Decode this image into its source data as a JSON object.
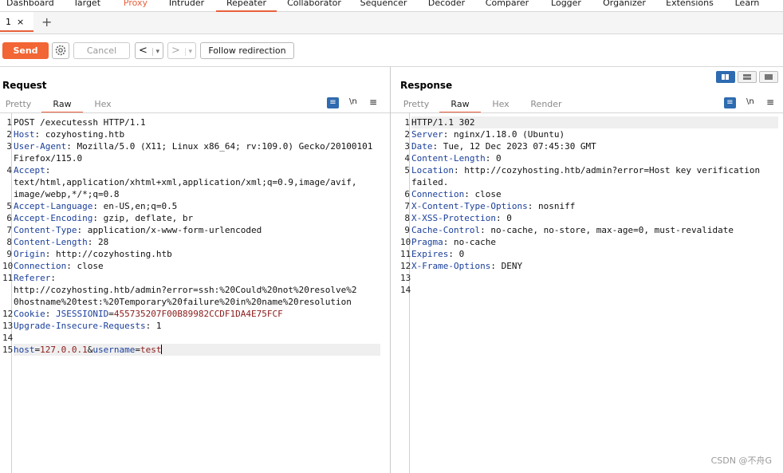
{
  "top_tabs": [
    "Dashboard",
    "Target",
    "Proxy",
    "Intruder",
    "Repeater",
    "Collaborator",
    "Sequencer",
    "Decoder",
    "Comparer",
    "Logger",
    "Organizer",
    "Extensions",
    "Learn"
  ],
  "repeater_tab": {
    "label": "1",
    "close": "×",
    "add": "+"
  },
  "toolbar": {
    "send": "Send",
    "cancel": "Cancel",
    "back": "<",
    "back_menu": "▾",
    "forward": ">",
    "forward_menu": "▾",
    "follow": "Follow redirection"
  },
  "request": {
    "title": "Request",
    "tabs": [
      "Pretty",
      "Raw",
      "Hex"
    ],
    "lines": [
      {
        "n": "1",
        "text": "POST /executessh HTTP/1.1"
      },
      {
        "n": "2",
        "key": "Host",
        "val": "cozyhosting.htb"
      },
      {
        "n": "3",
        "key": "User-Agent",
        "val": "Mozilla/5.0 (X11; Linux x86_64; rv:109.0) Gecko/20100101"
      },
      {
        "n": "",
        "text": "Firefox/115.0"
      },
      {
        "n": "4",
        "key": "Accept",
        "val": ""
      },
      {
        "n": "",
        "text": "text/html,application/xhtml+xml,application/xml;q=0.9,image/avif,"
      },
      {
        "n": "",
        "text": "image/webp,*/*;q=0.8"
      },
      {
        "n": "5",
        "key": "Accept-Language",
        "val": "en-US,en;q=0.5"
      },
      {
        "n": "6",
        "key": "Accept-Encoding",
        "val": "gzip, deflate, br"
      },
      {
        "n": "7",
        "key": "Content-Type",
        "val": "application/x-www-form-urlencoded"
      },
      {
        "n": "8",
        "key": "Content-Length",
        "val": "28"
      },
      {
        "n": "9",
        "key": "Origin",
        "val": "http://cozyhosting.htb"
      },
      {
        "n": "10",
        "key": "Connection",
        "val": "close"
      },
      {
        "n": "11",
        "key": "Referer",
        "val": ""
      },
      {
        "n": "",
        "text": "http://cozyhosting.htb/admin?error=ssh:%20Could%20not%20resolve%2"
      },
      {
        "n": "",
        "text": "0hostname%20test:%20Temporary%20failure%20in%20name%20resolution"
      },
      {
        "n": "12",
        "key": "Cookie",
        "cookie_name": "JSESSIONID",
        "cookie_val": "455735207F00B89982CCDF1DA4E75FCF"
      },
      {
        "n": "13",
        "key": "Upgrade-Insecure-Requests",
        "val": "1"
      },
      {
        "n": "14",
        "text": ""
      },
      {
        "n": "15",
        "body": [
          {
            "k": "host"
          },
          {
            "t": "="
          },
          {
            "v": "127.0.0.1"
          },
          {
            "t": "&"
          },
          {
            "k": "username"
          },
          {
            "t": "="
          },
          {
            "v": "test"
          }
        ],
        "hl": true
      }
    ]
  },
  "response": {
    "title": "Response",
    "tabs": [
      "Pretty",
      "Raw",
      "Hex",
      "Render"
    ],
    "lines": [
      {
        "n": "1",
        "text": "HTTP/1.1 302",
        "hl": true
      },
      {
        "n": "2",
        "key": "Server",
        "val": "nginx/1.18.0 (Ubuntu)"
      },
      {
        "n": "3",
        "key": "Date",
        "val": "Tue, 12 Dec 2023 07:45:30 GMT"
      },
      {
        "n": "4",
        "key": "Content-Length",
        "val": "0"
      },
      {
        "n": "5",
        "key": "Location",
        "val": "http://cozyhosting.htb/admin?error=Host key verification"
      },
      {
        "n": "",
        "text": "failed."
      },
      {
        "n": "6",
        "key": "Connection",
        "val": "close"
      },
      {
        "n": "7",
        "key": "X-Content-Type-Options",
        "val": "nosniff"
      },
      {
        "n": "8",
        "key": "X-XSS-Protection",
        "val": "0"
      },
      {
        "n": "9",
        "key": "Cache-Control",
        "val": "no-cache, no-store, max-age=0, must-revalidate"
      },
      {
        "n": "10",
        "key": "Pragma",
        "val": "no-cache"
      },
      {
        "n": "11",
        "key": "Expires",
        "val": "0"
      },
      {
        "n": "12",
        "key": "X-Frame-Options",
        "val": "DENY"
      },
      {
        "n": "13",
        "text": ""
      },
      {
        "n": "14",
        "text": ""
      }
    ]
  },
  "icons": {
    "wrap": "≡",
    "newline": "\\n",
    "menu": "≡"
  },
  "watermark": "CSDN @不舟G",
  "colors": {
    "accent": "#e8603c",
    "send": "#f26534",
    "toggle": "#2e6bb0",
    "header_key": "#1a3f9a",
    "header_value_red": "#8b1a1a"
  }
}
